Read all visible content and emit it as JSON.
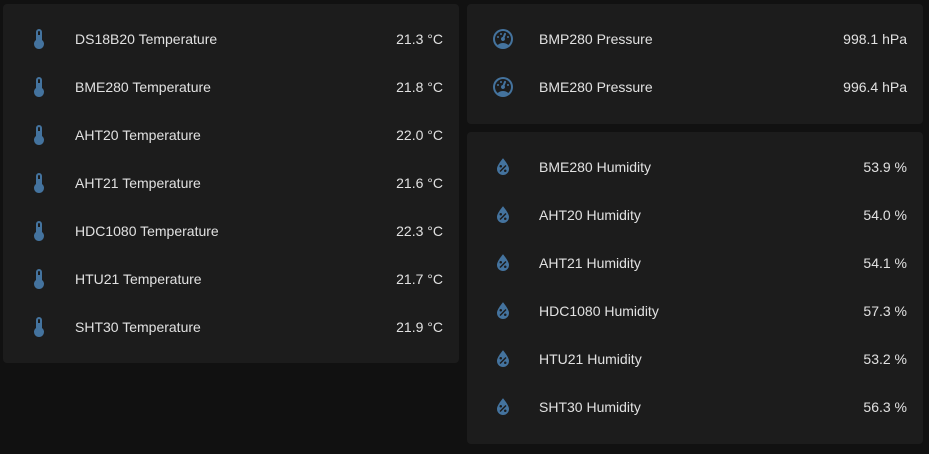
{
  "temperature_card": {
    "rows": [
      {
        "name": "DS18B20 Temperature",
        "value": "21.3 °C",
        "icon": "thermometer-icon"
      },
      {
        "name": "BME280 Temperature",
        "value": "21.8 °C",
        "icon": "thermometer-icon"
      },
      {
        "name": "AHT20 Temperature",
        "value": "22.0 °C",
        "icon": "thermometer-icon"
      },
      {
        "name": "AHT21 Temperature",
        "value": "21.6 °C",
        "icon": "thermometer-icon"
      },
      {
        "name": "HDC1080 Temperature",
        "value": "22.3 °C",
        "icon": "thermometer-icon"
      },
      {
        "name": "HTU21 Temperature",
        "value": "21.7 °C",
        "icon": "thermometer-icon"
      },
      {
        "name": "SHT30 Temperature",
        "value": "21.9 °C",
        "icon": "thermometer-icon"
      }
    ]
  },
  "pressure_card": {
    "rows": [
      {
        "name": "BMP280 Pressure",
        "value": "998.1 hPa",
        "icon": "gauge-icon"
      },
      {
        "name": "BME280 Pressure",
        "value": "996.4 hPa",
        "icon": "gauge-icon"
      }
    ]
  },
  "humidity_card": {
    "rows": [
      {
        "name": "BME280 Humidity",
        "value": "53.9 %",
        "icon": "water-percent-icon"
      },
      {
        "name": "AHT20 Humidity",
        "value": "54.0 %",
        "icon": "water-percent-icon"
      },
      {
        "name": "AHT21 Humidity",
        "value": "54.1 %",
        "icon": "water-percent-icon"
      },
      {
        "name": "HDC1080 Humidity",
        "value": "57.3 %",
        "icon": "water-percent-icon"
      },
      {
        "name": "HTU21 Humidity",
        "value": "53.2 %",
        "icon": "water-percent-icon"
      },
      {
        "name": "SHT30 Humidity",
        "value": "56.3 %",
        "icon": "water-percent-icon"
      }
    ]
  },
  "colors": {
    "background": "#111111",
    "card": "#1c1c1c",
    "text": "#e1e1e1",
    "icon": "#44739e"
  }
}
